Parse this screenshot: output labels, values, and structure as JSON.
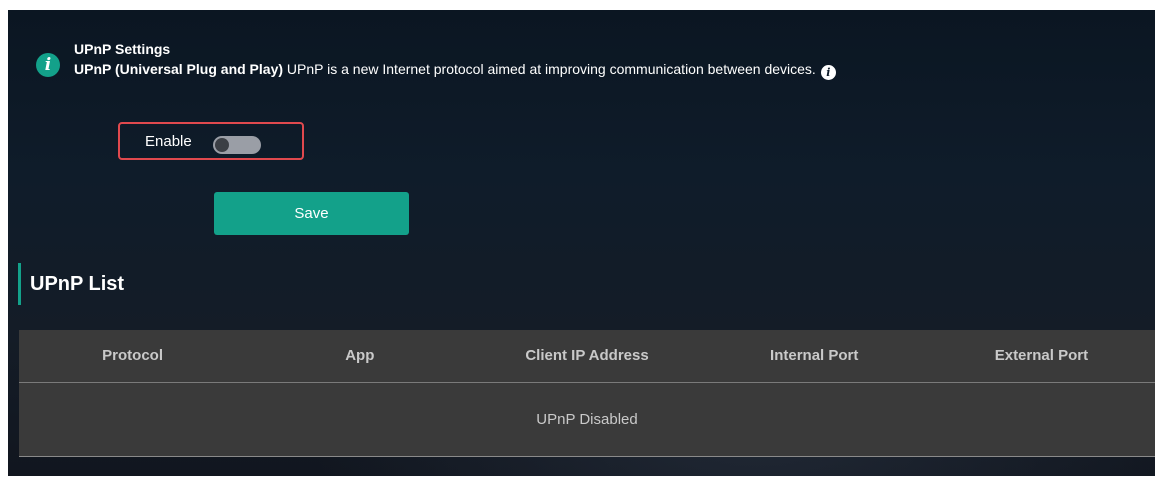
{
  "info": {
    "title": "UPnP Settings",
    "desc_strong": "UPnP  (Universal Plug and Play)",
    "desc_text": " UPnP is a new Internet protocol aimed at improving communication between devices."
  },
  "settings": {
    "enable_label": "Enable",
    "enable_on": false,
    "save_label": "Save"
  },
  "upnp_list": {
    "title": "UPnP List",
    "columns": [
      "Protocol",
      "App",
      "Client IP Address",
      "Internal Port",
      "External Port"
    ],
    "empty_message": "UPnP Disabled"
  },
  "colors": {
    "accent": "#13a18a",
    "highlight_border": "#e0494e",
    "background": "#0f1c2a",
    "table_bg": "#3a3a3a"
  },
  "icons": {
    "info": "info-icon",
    "help": "help-icon"
  }
}
